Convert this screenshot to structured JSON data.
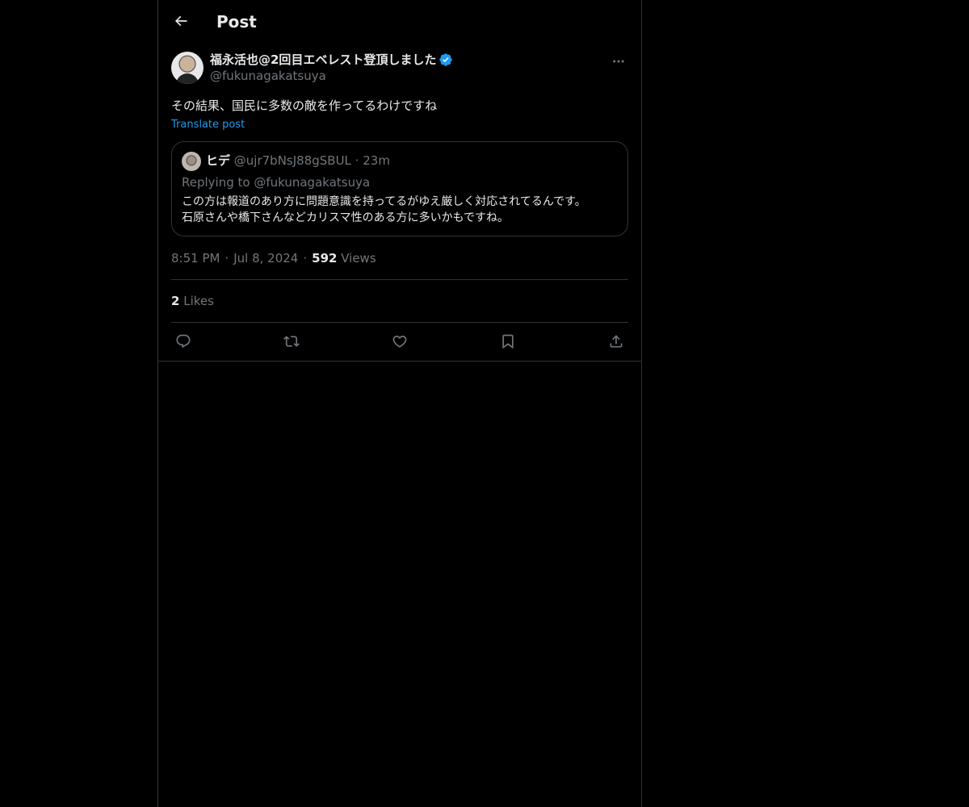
{
  "header": {
    "title": "Post",
    "back_icon": "arrow-left-icon"
  },
  "post": {
    "author": {
      "display_name": "福永活也@2回目エベレスト登頂しました",
      "handle": "@fukunagakatsuya",
      "verified": true,
      "verified_color": "#1d9bf0"
    },
    "text": "その結果、国民に多数の敵を作ってるわけですね",
    "translate_label": "Translate post",
    "quote": {
      "name": "ヒデ",
      "handle": "@ujr7bNsJ88gSBUL",
      "separator": "·",
      "time": "23m",
      "replying_to": "Replying to @fukunagakatsuya",
      "body_line1": "この方は報道のあり方に問題意識を持ってるがゆえ厳しく対応されてるんです。",
      "body_line2": "石原さんや橋下さんなどカリスマ性のある方に多いかもですね。"
    },
    "meta": {
      "time": "8:51 PM",
      "separator": "·",
      "date": "Jul 8, 2024",
      "views_count": "592",
      "views_label": "Views"
    },
    "likes": {
      "count": "2",
      "label": "Likes"
    },
    "actions": [
      {
        "icon": "reply-icon"
      },
      {
        "icon": "repost-icon"
      },
      {
        "icon": "like-icon"
      },
      {
        "icon": "bookmark-icon"
      },
      {
        "icon": "share-icon"
      }
    ]
  },
  "colors": {
    "background": "#000000",
    "text": "#e7e9ea",
    "muted": "#71767b",
    "accent": "#1d9bf0",
    "border": "#2f3336"
  }
}
